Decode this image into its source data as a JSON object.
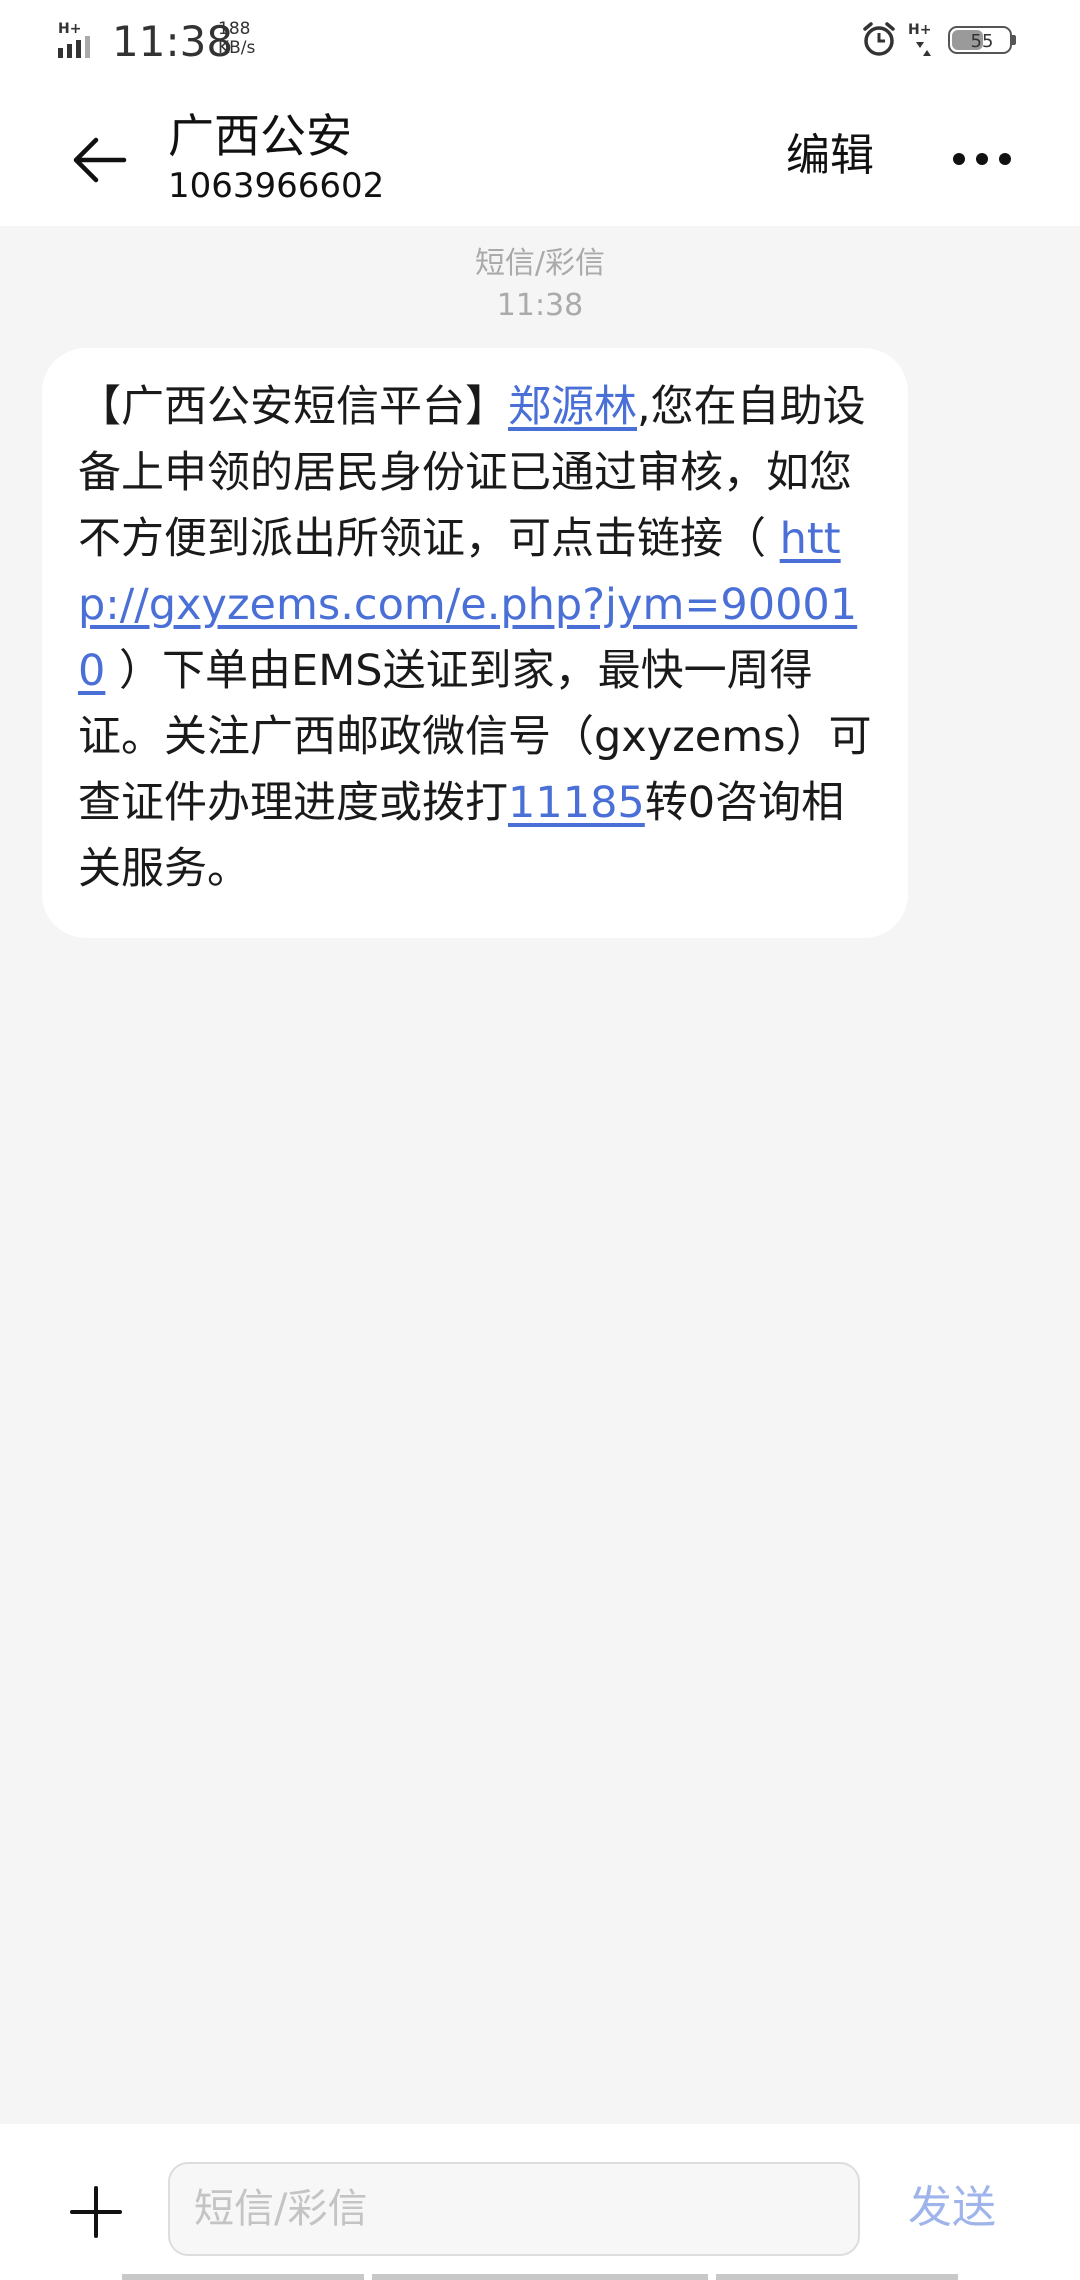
{
  "status_bar": {
    "network_type": "H+",
    "time": "11:38",
    "net_speed_value": "188",
    "net_speed_unit": "KB/s",
    "battery_level": "55",
    "battery_fraction": 0.55,
    "icons": [
      "signal-icon",
      "alarm-clock-icon",
      "hd-signal-icon",
      "battery-icon"
    ]
  },
  "header": {
    "contact_name": "广西公安",
    "contact_number": "1063966602",
    "edit_label": "编辑",
    "back_icon": "back-arrow-icon",
    "more_icon": "more-dots-icon"
  },
  "conversation": {
    "type_label": "短信/彩信",
    "time_label": "11:38",
    "message": {
      "p1": "【广西公安短信平台】",
      "name_link": "郑源林",
      "p2": ",您在自助设备上申领的居民身份证已通过审核，如您不方便到派出所领证，可点击链接（ ",
      "url_link": "http://gxyzems.com/e.php?jym=900010",
      "p3": " ）下单由EMS送证到家，最快一周得证。关注广西邮政微信号（gxyzems）可查证件办理进度或拨打",
      "phone_link": "11185",
      "p4": "转0咨询相关服务。"
    }
  },
  "composer": {
    "input_placeholder": "短信/彩信",
    "input_value": "",
    "send_label": "发送",
    "attach_icon": "plus-icon"
  },
  "colors": {
    "link": "#4a6fd6",
    "send_disabled": "#9fb4ea",
    "background": "#f5f5f5",
    "bubble": "#ffffff"
  }
}
